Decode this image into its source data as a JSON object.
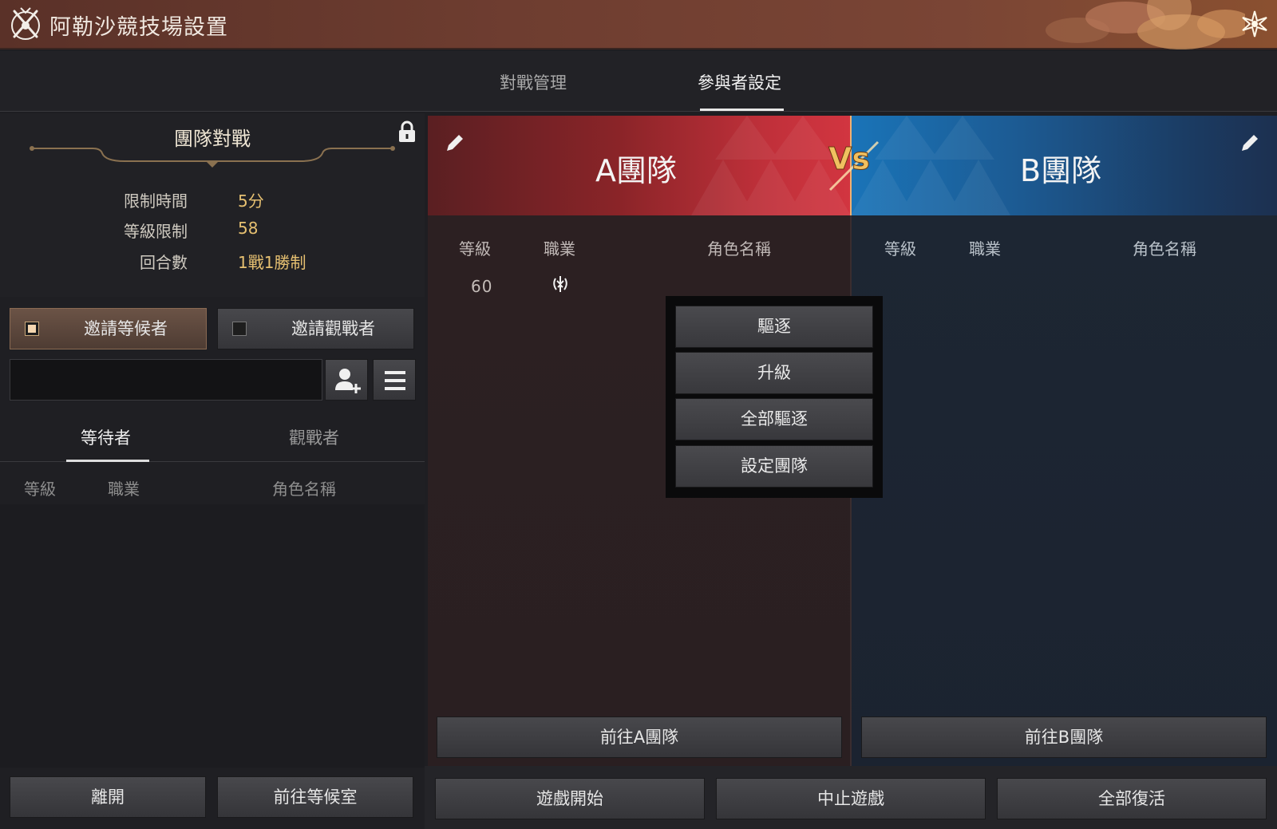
{
  "window": {
    "title": "阿勒沙競技場設置"
  },
  "top_tabs": [
    {
      "label": "對戰管理",
      "active": false
    },
    {
      "label": "參與者設定",
      "active": true
    }
  ],
  "settings": {
    "mode_title": "團隊對戰",
    "rows": [
      {
        "label": "限制時間",
        "value": "5分"
      },
      {
        "label": "等級限制",
        "value": "58"
      },
      {
        "label": "回合數",
        "value": "1戰1勝制"
      }
    ]
  },
  "invite": {
    "waiting_label": "邀請等候者",
    "waiting_checked": true,
    "spectator_label": "邀請觀戰者",
    "spectator_checked": false
  },
  "search": {
    "value": "",
    "placeholder": ""
  },
  "sub_tabs": [
    {
      "label": "等待者",
      "active": true
    },
    {
      "label": "觀戰者",
      "active": false
    }
  ],
  "waiting_columns": {
    "level": "等級",
    "class": "職業",
    "name": "角色名稱"
  },
  "left_buttons": {
    "leave": "離開",
    "goto_waiting": "前往等候室"
  },
  "team_a": {
    "name": "A團隊",
    "color": "#c0303a",
    "columns": {
      "level": "等級",
      "class": "職業",
      "name": "角色名稱"
    },
    "members": [
      {
        "level": "60",
        "class_icon": "class-emblem-icon",
        "name": ""
      }
    ],
    "goto_label": "前往A團隊"
  },
  "team_b": {
    "name": "B團隊",
    "color": "#1a74b8",
    "columns": {
      "level": "等級",
      "class": "職業",
      "name": "角色名稱"
    },
    "members": [],
    "goto_label": "前往B團隊"
  },
  "vs_label": "Vs",
  "context_menu": [
    "驅逐",
    "升級",
    "全部驅逐",
    "設定團隊"
  ],
  "game_buttons": {
    "start": "遊戲開始",
    "stop": "中止遊戲",
    "revive_all": "全部復活"
  }
}
